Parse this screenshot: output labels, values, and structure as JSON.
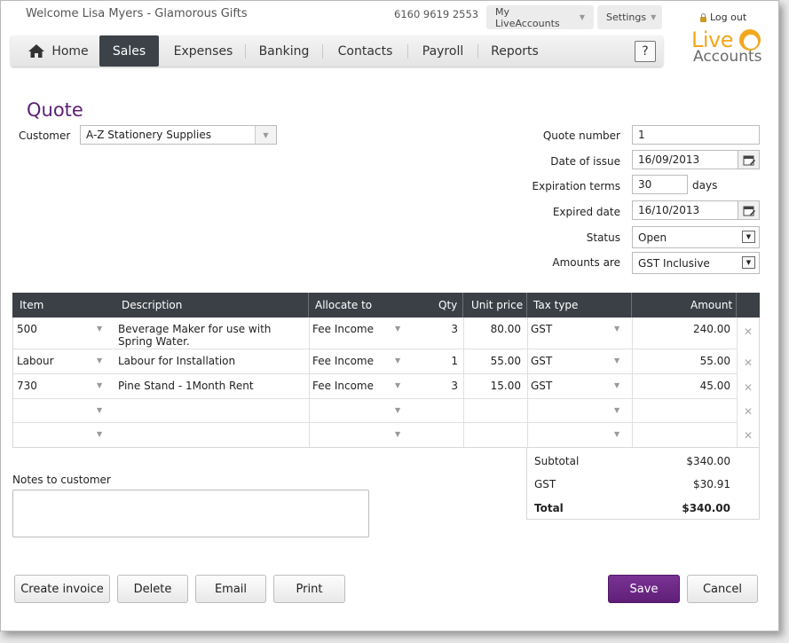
{
  "header": {
    "welcome": "Welcome Lisa Myers - Glamorous Gifts",
    "phone": "6160 9619 2553",
    "my_live_accounts": "My LiveAccounts",
    "settings": "Settings",
    "logout": "Log out",
    "logo_live": "Live",
    "logo_accounts": "Accounts"
  },
  "nav": {
    "home": "Home",
    "sales": "Sales",
    "expenses": "Expenses",
    "banking": "Banking",
    "contacts": "Contacts",
    "payroll": "Payroll",
    "reports": "Reports",
    "help": "?",
    "active": "Sales"
  },
  "form": {
    "title": "Quote",
    "customer_label": "Customer",
    "customer_value": "A-Z Stationery Supplies",
    "quote_number_label": "Quote number",
    "quote_number": "1",
    "date_of_issue_label": "Date of issue",
    "date_of_issue": "16/09/2013",
    "expiration_terms_label": "Expiration terms",
    "expiration_terms": "30",
    "days_label": "days",
    "expired_date_label": "Expired date",
    "expired_date": "16/10/2013",
    "status_label": "Status",
    "status": "Open",
    "amounts_are_label": "Amounts are",
    "amounts_are": "GST Inclusive"
  },
  "table": {
    "headers": {
      "item": "Item",
      "description": "Description",
      "allocate_to": "Allocate to",
      "qty": "Qty",
      "unit_price": "Unit price",
      "tax_type": "Tax type",
      "amount": "Amount"
    },
    "rows": [
      {
        "item": "500",
        "description": "Beverage Maker for use with",
        "description2": "Spring Water.",
        "allocate_to": "Fee Income",
        "qty": "3",
        "unit_price": "80.00",
        "tax_type": "GST",
        "amount": "240.00"
      },
      {
        "item": "Labour",
        "description": "Labour for Installation",
        "description2": "",
        "allocate_to": "Fee Income",
        "qty": "1",
        "unit_price": "55.00",
        "tax_type": "GST",
        "amount": "55.00"
      },
      {
        "item": "730",
        "description": "Pine Stand - 1Month Rent",
        "description2": "",
        "allocate_to": "Fee Income",
        "qty": "3",
        "unit_price": "15.00",
        "tax_type": "GST",
        "amount": "45.00"
      }
    ]
  },
  "totals": {
    "subtotal_label": "Subtotal",
    "subtotal": "$340.00",
    "gst_label": "GST",
    "gst": "$30.91",
    "total_label": "Total",
    "total": "$340.00"
  },
  "notes": {
    "label": "Notes to customer",
    "value": ""
  },
  "actions": {
    "create_invoice": "Create invoice",
    "delete": "Delete",
    "email": "Email",
    "print": "Print",
    "save": "Save",
    "cancel": "Cancel"
  },
  "colors": {
    "accent": "#5c1f73",
    "nav_active": "#3c4248",
    "logo_orange": "#f2a81d"
  }
}
